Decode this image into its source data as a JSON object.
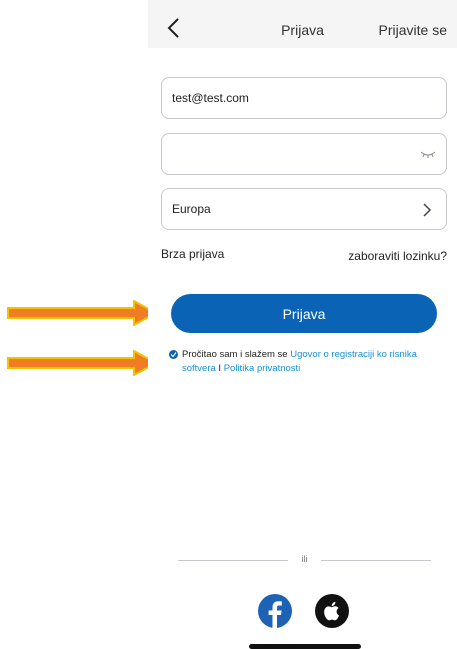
{
  "header": {
    "title": "Prijava",
    "right_action": "Prijavite se"
  },
  "form": {
    "email_value": "test@test.com",
    "password_value": "",
    "region_value": "Europa"
  },
  "links": {
    "quick_login": "Brza prijava",
    "forgot_password": "zaboraviti lozinku?"
  },
  "login_button_label": "Prijava",
  "consent": {
    "prefix": "Pročitao sam i slažem se ",
    "agreement_link": "Ugovor o registraciji ko risnika softvera",
    "separator": " I ",
    "privacy_link": "Politika privatnosti",
    "checked": true
  },
  "divider_text": "ili",
  "social": {
    "icons": [
      "facebook-icon",
      "apple-icon"
    ]
  },
  "colors": {
    "primary": "#0a63b5",
    "link": "#1a8fd6",
    "arrow": "#f07d23",
    "arrow_outline": "#f3c300"
  }
}
